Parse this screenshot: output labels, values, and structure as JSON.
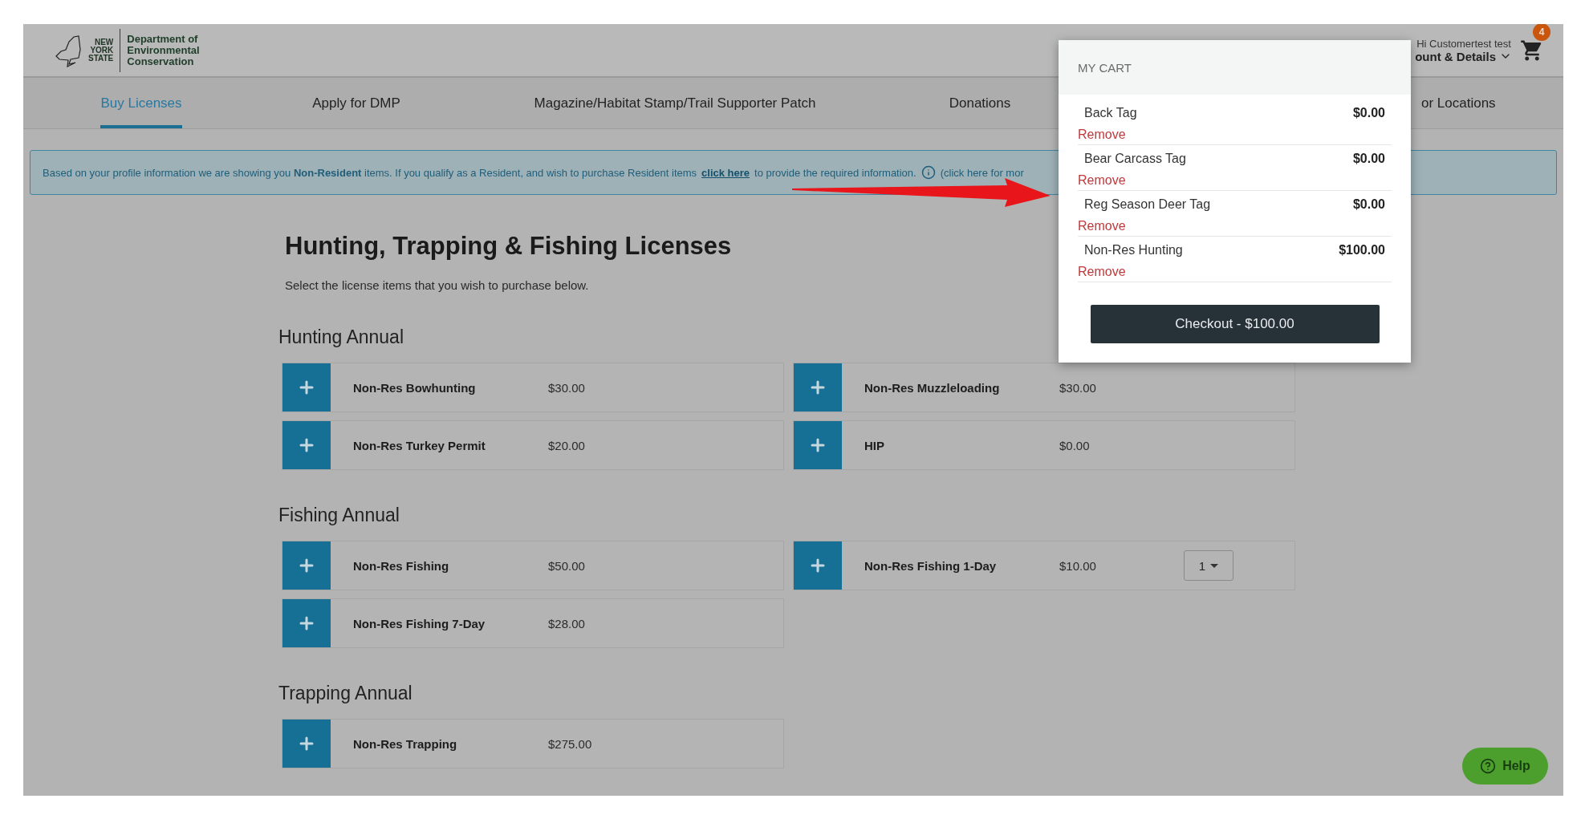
{
  "header": {
    "logo": {
      "state_lines": [
        "NEW",
        "YORK",
        "STATE"
      ],
      "org_lines": [
        "Department of",
        "Environmental",
        "Conservation"
      ]
    },
    "greeting": "Hi Customertest test",
    "account": "ount & Details",
    "cart_count": "4"
  },
  "nav": [
    {
      "label": "Buy Licenses",
      "selected": true
    },
    {
      "label": "Apply for DMP",
      "selected": false
    },
    {
      "label": "Magazine/Habitat Stamp/Trail Supporter Patch",
      "selected": false
    },
    {
      "label": "Donations",
      "selected": false
    },
    {
      "label": "or Locations",
      "selected": false
    }
  ],
  "notice": {
    "text": "Based on your profile information we are showing you **Non-Resident** items. If you qualify as a Resident, and wish to purchase Resident items",
    "link": "click here",
    "after": "to provide the required information.",
    "more": "(click here for mor"
  },
  "page": {
    "title": "Hunting, Trapping & Fishing Licenses",
    "subtitle": "Select the license items that you wish to purchase below.",
    "sections": [
      {
        "heading": "Hunting Annual",
        "items": [
          {
            "name": "Non-Res Bowhunting",
            "price": "$30.00"
          },
          {
            "name": "Non-Res Muzzleloading",
            "price": "$30.00"
          },
          {
            "name": "Non-Res Turkey Permit",
            "price": "$20.00"
          },
          {
            "name": "HIP",
            "price": "$0.00"
          }
        ]
      },
      {
        "heading": "Fishing Annual",
        "items": [
          {
            "name": "Non-Res Fishing",
            "price": "$50.00"
          },
          {
            "name": "Non-Res Fishing 1-Day",
            "price": "$10.00",
            "quantity": "1"
          },
          {
            "name": "Non-Res Fishing 7-Day",
            "price": "$28.00"
          }
        ]
      },
      {
        "heading": "Trapping Annual",
        "items": [
          {
            "name": "Non-Res Trapping",
            "price": "$275.00"
          }
        ]
      }
    ]
  },
  "cart": {
    "title": "MY CART",
    "items": [
      {
        "name": "Back Tag",
        "price": "$0.00",
        "action": "Remove"
      },
      {
        "name": "Bear Carcass Tag",
        "price": "$0.00",
        "action": "Remove"
      },
      {
        "name": "Reg Season Deer Tag",
        "price": "$0.00",
        "action": "Remove"
      },
      {
        "name": "Non-Res Hunting",
        "price": "$100.00",
        "action": "Remove"
      }
    ],
    "checkout": "Checkout - $100.00"
  },
  "help": "Help"
}
